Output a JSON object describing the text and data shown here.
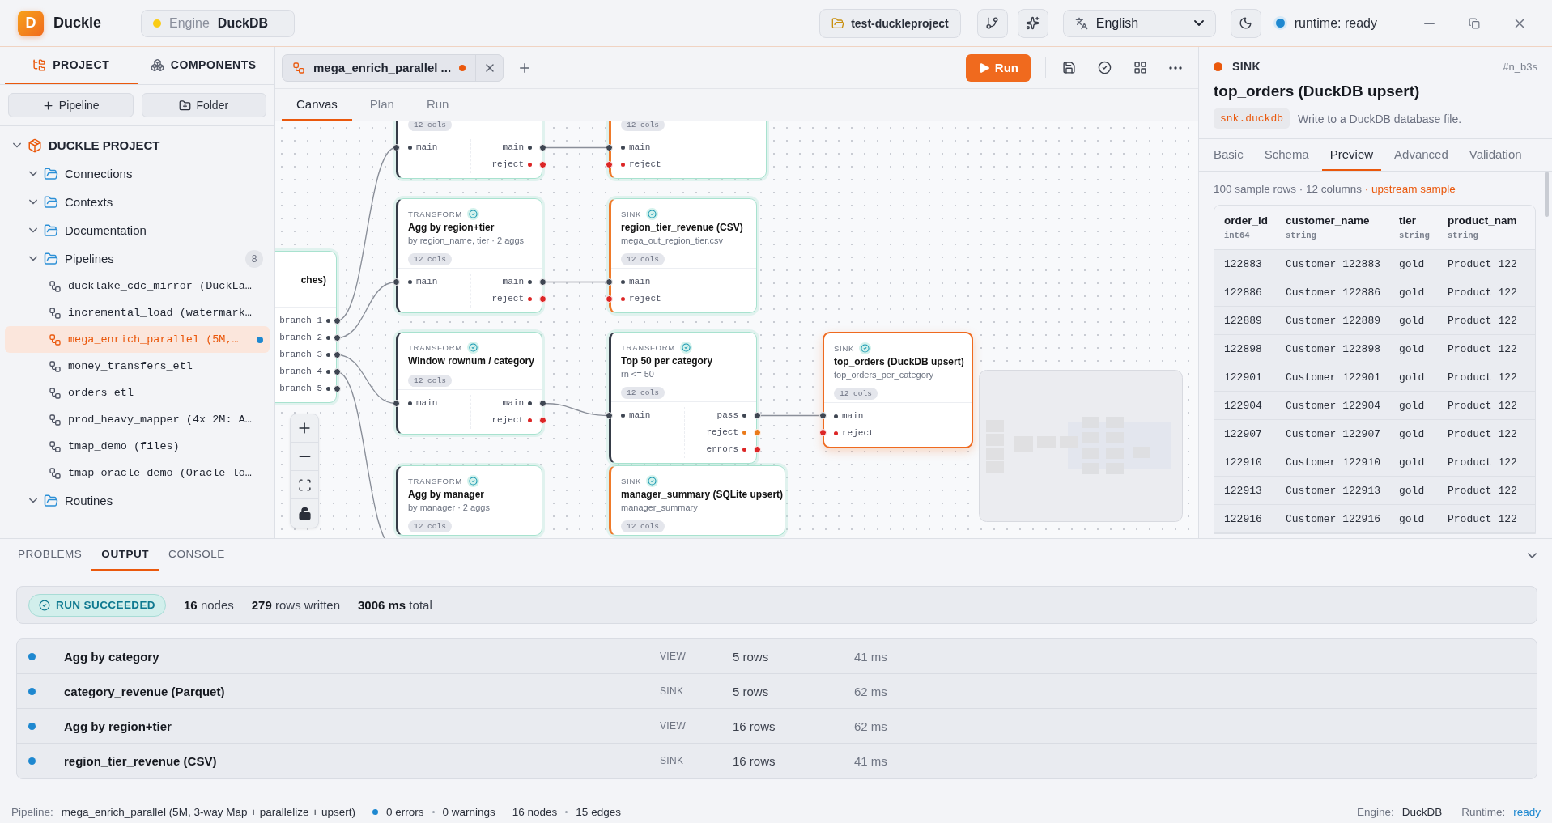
{
  "app": {
    "logo_letter": "D",
    "name": "Duckle"
  },
  "engine_select": {
    "label": "Engine",
    "value": "DuckDB"
  },
  "toolbar": {
    "project": "test-duckleproject",
    "language": "English",
    "runtime": "runtime: ready"
  },
  "sidebar": {
    "tabs": [
      {
        "label": "PROJECT",
        "selected": true
      },
      {
        "label": "COMPONENTS",
        "selected": false
      }
    ],
    "buttons": [
      {
        "label": "Pipeline",
        "kind": "add"
      },
      {
        "label": "Folder",
        "kind": "folder"
      }
    ],
    "tree": [
      {
        "label": "DUCKLE PROJECT",
        "kind": "project",
        "expanded": true,
        "children": [
          {
            "label": "Connections",
            "kind": "folder",
            "expanded": true
          },
          {
            "label": "Contexts",
            "kind": "folder",
            "expanded": true
          },
          {
            "label": "Documentation",
            "kind": "folder",
            "expanded": true
          },
          {
            "label": "Pipelines",
            "kind": "folder",
            "expanded": true,
            "count": "8",
            "children": [
              {
                "label": "ducklake_cdc_mirror (DuckLa…",
                "kind": "pipeline",
                "selected": false,
                "modified": false
              },
              {
                "label": "incremental_load (watermark…",
                "kind": "pipeline",
                "selected": false,
                "modified": false
              },
              {
                "label": "mega_enrich_parallel (5M,…",
                "kind": "pipeline",
                "selected": true,
                "modified": true
              },
              {
                "label": "money_transfers_etl",
                "kind": "pipeline",
                "selected": false,
                "modified": false
              },
              {
                "label": "orders_etl",
                "kind": "pipeline",
                "selected": false,
                "modified": false
              },
              {
                "label": "prod_heavy_mapper (4x 2M: A…",
                "kind": "pipeline",
                "selected": false,
                "modified": false
              },
              {
                "label": "tmap_demo (files)",
                "kind": "pipeline",
                "selected": false,
                "modified": false
              },
              {
                "label": "tmap_oracle_demo (Oracle lo…",
                "kind": "pipeline",
                "selected": false,
                "modified": false
              }
            ]
          },
          {
            "label": "Routines",
            "kind": "folder",
            "expanded": true
          }
        ]
      }
    ]
  },
  "editor": {
    "tabs": [
      {
        "label": "mega_enrich_parallel ...",
        "selected": true,
        "unsaved": true
      }
    ],
    "run_button": "Run",
    "view_tabs": [
      {
        "label": "Canvas",
        "selected": true
      },
      {
        "label": "Plan",
        "selected": false
      },
      {
        "label": "Run",
        "selected": false
      }
    ]
  },
  "canvas": {
    "nodes": [
      {
        "kind": "transform",
        "selected": false,
        "cols": "12 cols",
        "inputs": [
          {
            "label": "main",
            "color": "#3f4652"
          }
        ],
        "outputs": [
          {
            "label": "main",
            "color": "#3f4652"
          },
          {
            "label": "reject",
            "color": "#dc2626"
          }
        ]
      },
      {
        "kind": "sink",
        "selected": false,
        "cols": "12 cols",
        "inputs": [
          {
            "label": "main",
            "color": "#3f4652"
          },
          {
            "label": "reject",
            "color": "#dc2626"
          }
        ]
      },
      {
        "kind": "transform",
        "selected": false,
        "type_label": "TRANSFORM",
        "title": "Agg by region+tier",
        "subtitle": "by region_name, tier · 2 aggs",
        "cols": "12 cols",
        "inputs": [
          {
            "label": "main",
            "color": "#3f4652"
          }
        ],
        "outputs": [
          {
            "label": "main",
            "color": "#3f4652"
          },
          {
            "label": "reject",
            "color": "#dc2626"
          }
        ]
      },
      {
        "kind": "sink",
        "selected": false,
        "type_label": "SINK",
        "title": "region_tier_revenue (CSV)",
        "subtitle": "mega_out_region_tier.csv",
        "cols": "12 cols",
        "inputs": [
          {
            "label": "main",
            "color": "#3f4652"
          },
          {
            "label": "reject",
            "color": "#dc2626"
          }
        ]
      },
      {
        "kind": "branch",
        "selected": false,
        "title": "ches)",
        "outputs": [
          {
            "label": "branch 1",
            "color": "#3f4652"
          },
          {
            "label": "branch 2",
            "color": "#3f4652"
          },
          {
            "label": "branch 3",
            "color": "#3f4652"
          },
          {
            "label": "branch 4",
            "color": "#3f4652"
          },
          {
            "label": "branch 5",
            "color": "#3f4652"
          }
        ]
      },
      {
        "kind": "transform",
        "selected": false,
        "type_label": "TRANSFORM",
        "title": "Window rownum / category",
        "cols": "12 cols",
        "inputs": [
          {
            "label": "main",
            "color": "#3f4652"
          }
        ],
        "outputs": [
          {
            "label": "main",
            "color": "#3f4652"
          },
          {
            "label": "reject",
            "color": "#dc2626"
          }
        ]
      },
      {
        "kind": "transform",
        "selected": false,
        "type_label": "TRANSFORM",
        "title": "Top 50 per category",
        "subtitle": "rn <= 50",
        "cols": "12 cols",
        "inputs": [
          {
            "label": "main",
            "color": "#3f4652"
          }
        ],
        "outputs": [
          {
            "label": "pass",
            "color": "#3f4652"
          },
          {
            "label": "reject",
            "color": "#ea7a1a"
          },
          {
            "label": "errors",
            "color": "#dc2626"
          }
        ]
      },
      {
        "kind": "sink",
        "selected": true,
        "type_label": "SINK",
        "title": "top_orders (DuckDB upsert)",
        "subtitle": "top_orders_per_category",
        "cols": "12 cols",
        "inputs": [
          {
            "label": "main",
            "color": "#3f4652"
          },
          {
            "label": "reject",
            "color": "#dc2626"
          }
        ]
      },
      {
        "kind": "transform",
        "selected": false,
        "type_label": "TRANSFORM",
        "title": "Agg by manager",
        "subtitle": "by manager · 2 aggs",
        "cols": "12 cols"
      },
      {
        "kind": "sink",
        "selected": false,
        "type_label": "SINK",
        "title": "manager_summary (SQLite upsert)",
        "subtitle": "manager_summary",
        "cols": "12 cols"
      }
    ]
  },
  "inspector": {
    "kind_label": "SINK",
    "id": "#n_b3s",
    "title": "top_orders (DuckDB upsert)",
    "component": "snk.duckdb",
    "description": "Write to a DuckDB database file.",
    "tabs": [
      {
        "label": "Basic",
        "selected": false
      },
      {
        "label": "Schema",
        "selected": false
      },
      {
        "label": "Preview",
        "selected": true
      },
      {
        "label": "Advanced",
        "selected": false
      },
      {
        "label": "Validation",
        "selected": false
      }
    ],
    "summary": "100 sample rows · 12 columns",
    "summary_link": "· upstream sample",
    "table": {
      "columns": [
        {
          "name": "order_id",
          "type": "int64"
        },
        {
          "name": "customer_name",
          "type": "string"
        },
        {
          "name": "tier",
          "type": "string"
        },
        {
          "name": "product_nam",
          "type": "string"
        }
      ],
      "rows": [
        [
          "122883",
          "Customer 122883",
          "gold",
          "Product 122"
        ],
        [
          "122886",
          "Customer 122886",
          "gold",
          "Product 122"
        ],
        [
          "122889",
          "Customer 122889",
          "gold",
          "Product 122"
        ],
        [
          "122898",
          "Customer 122898",
          "gold",
          "Product 122"
        ],
        [
          "122901",
          "Customer 122901",
          "gold",
          "Product 122"
        ],
        [
          "122904",
          "Customer 122904",
          "gold",
          "Product 122"
        ],
        [
          "122907",
          "Customer 122907",
          "gold",
          "Product 122"
        ],
        [
          "122910",
          "Customer 122910",
          "gold",
          "Product 122"
        ],
        [
          "122913",
          "Customer 122913",
          "gold",
          "Product 122"
        ],
        [
          "122916",
          "Customer 122916",
          "gold",
          "Product 122"
        ]
      ]
    }
  },
  "output": {
    "tabs": [
      {
        "label": "PROBLEMS",
        "selected": false
      },
      {
        "label": "OUTPUT",
        "selected": true
      },
      {
        "label": "CONSOLE",
        "selected": false
      }
    ],
    "status": "RUN SUCCEEDED",
    "stats": [
      "**16** nodes",
      "**279** rows written",
      "**3006 ms** total"
    ],
    "rows": [
      {
        "name": "Agg by category",
        "kind": "VIEW",
        "rows": "5 rows",
        "time": "41 ms"
      },
      {
        "name": "category_revenue (Parquet)",
        "kind": "SINK",
        "rows": "5 rows",
        "time": "62 ms"
      },
      {
        "name": "Agg by region+tier",
        "kind": "VIEW",
        "rows": "16 rows",
        "time": "62 ms"
      },
      {
        "name": "region_tier_revenue (CSV)",
        "kind": "SINK",
        "rows": "16 rows",
        "time": "41 ms"
      }
    ]
  },
  "status_bar": {
    "pipeline_label": "Pipeline:",
    "pipeline": "mega_enrich_parallel (5M, 3-way Map + parallelize + upsert)",
    "errors": "0 errors",
    "warnings": "0 warnings",
    "nodes": "16 nodes",
    "edges": "15 edges",
    "engine_label": "Engine:",
    "engine": "DuckDB",
    "runtime_label": "Runtime:",
    "runtime": "ready"
  }
}
